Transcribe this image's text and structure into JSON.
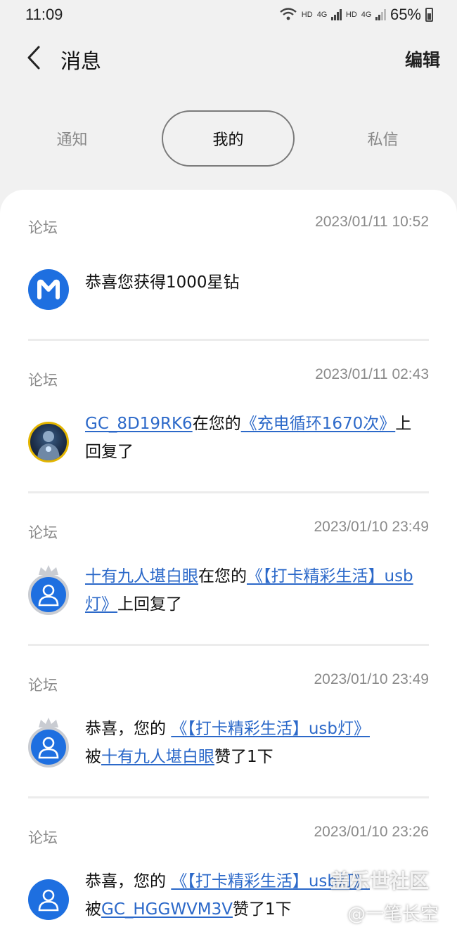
{
  "status_bar": {
    "time": "11:09",
    "hd1": "HD",
    "net1": "4G",
    "hd2": "HD",
    "net2": "4G",
    "battery": "65%",
    "icons": [
      "wifi-icon",
      "signal-icon",
      "signal-icon",
      "battery-icon"
    ]
  },
  "header": {
    "back_icon": "chevron-left-icon",
    "title": "消息",
    "edit_label": "编辑"
  },
  "tabs": [
    {
      "label": "通知",
      "active": false
    },
    {
      "label": "我的",
      "active": true
    },
    {
      "label": "私信",
      "active": false
    }
  ],
  "messages": [
    {
      "source": "论坛",
      "time": "2023/01/11 10:52",
      "avatar": "members-logo",
      "text": "恭喜您获得1000星钻"
    },
    {
      "source": "论坛",
      "time": "2023/01/11 02:43",
      "avatar": "user-photo",
      "user": "GC_8D19RK6",
      "mid": "在您的",
      "post": "《充电循环1670次》",
      "tail": "上回复了"
    },
    {
      "source": "论坛",
      "time": "2023/01/10 23:49",
      "avatar": "user-icon-crowned",
      "user": "十有九人堪白眼",
      "mid": "在您的",
      "post": "《【打卡精彩生活】usb灯》",
      "tail": "上回复了"
    },
    {
      "source": "论坛",
      "time": "2023/01/10 23:49",
      "avatar": "user-icon-crowned",
      "prefix": "恭喜，您的",
      "post": "《【打卡精彩生活】usb灯》",
      "mid": "被",
      "user": "十有九人堪白眼",
      "tail": "赞了1下"
    },
    {
      "source": "论坛",
      "time": "2023/01/10 23:26",
      "avatar": "user-icon",
      "prefix": "恭喜，您的",
      "post": "《【打卡精彩生活】usb灯》",
      "mid": "被",
      "user": "GC_HGGWVM3V",
      "tail": "赞了1下"
    }
  ],
  "watermark": {
    "line1": "盖乐世社区",
    "line2": "@一笔长空"
  },
  "colors": {
    "background": "#f1f1f1",
    "card": "#ffffff",
    "link": "#2c69c9",
    "avatar_blue": "#1e6fe0",
    "muted_text": "#8a8a8a"
  }
}
